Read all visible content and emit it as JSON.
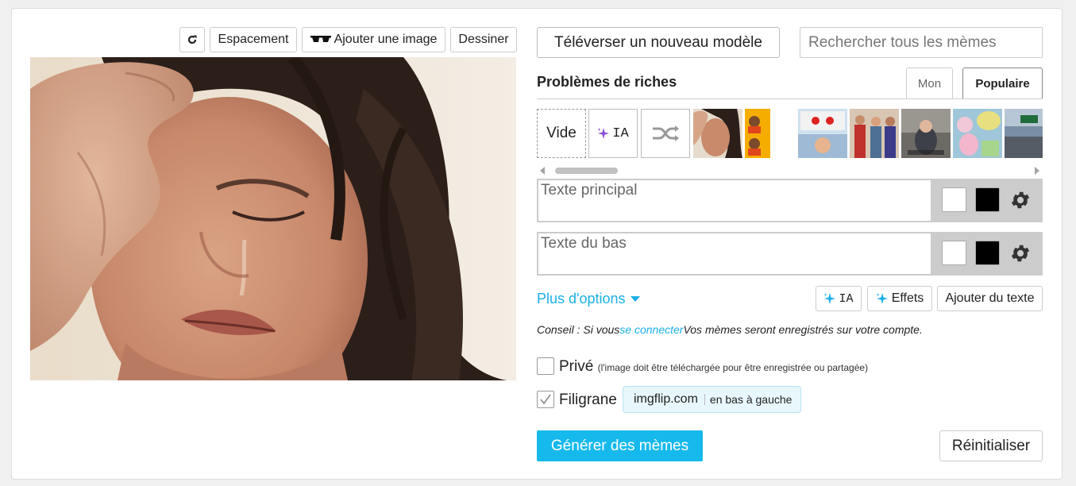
{
  "toolbar": {
    "spacing_label": "Espacement",
    "add_image_label": "Ajouter une image",
    "draw_label": "Dessiner"
  },
  "top": {
    "upload_label": "Téléverser un nouveau modèle",
    "search_placeholder": "Rechercher tous les mèmes"
  },
  "templates": {
    "title": "Problèmes de riches",
    "tabs": [
      "Mon",
      "Populaire"
    ],
    "active_tab": "Populaire",
    "blank_label": "Vide",
    "ai_label": "IA",
    "icons": [
      "sparkle-icon",
      "shuffle-icon"
    ]
  },
  "text_boxes": [
    {
      "placeholder": "Texte principal",
      "outline_color": "#ffffff",
      "fill_color": "#000000"
    },
    {
      "placeholder": "Texte du bas",
      "outline_color": "#ffffff",
      "fill_color": "#000000"
    }
  ],
  "options": {
    "more_options_label": "Plus d'options",
    "ai_label": "IA",
    "effects_label": "Effets",
    "add_text_label": "Ajouter du texte"
  },
  "tip": {
    "prefix": "Conseil : Si vous",
    "link": "se connecter",
    "suffix": "Vos mèmes seront enregistrés sur votre compte."
  },
  "private": {
    "label": "Privé",
    "note": "(l'image doit être téléchargée pour être enregistrée ou partagée)",
    "checked": false
  },
  "watermark": {
    "label": "Filigrane",
    "checked": true,
    "text": "imgflip.com",
    "position": "en bas à gauche"
  },
  "actions": {
    "generate_label": "Générer des mèmes",
    "reset_label": "Réinitialiser"
  },
  "colors": {
    "accent": "#16b9ec",
    "link": "#1ab0e6"
  }
}
